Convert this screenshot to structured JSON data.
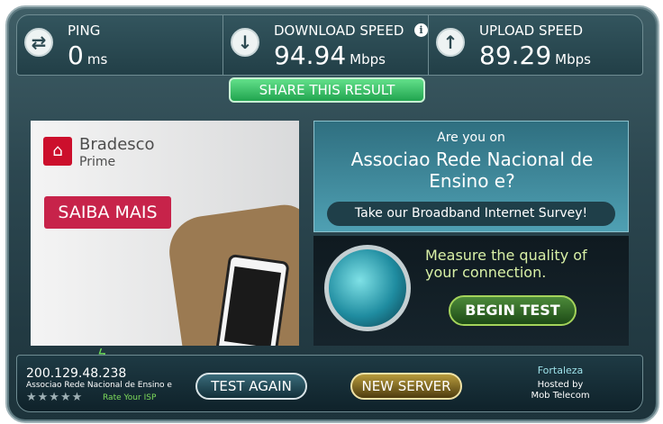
{
  "metrics": {
    "ping": {
      "label": "PING",
      "value": "0",
      "unit": "ms",
      "icon": "arrows-exchange-icon"
    },
    "download": {
      "label": "DOWNLOAD SPEED",
      "value": "94.94",
      "unit": "Mbps",
      "icon": "arrow-down-icon",
      "info": "i"
    },
    "upload": {
      "label": "UPLOAD SPEED",
      "value": "89.29",
      "unit": "Mbps",
      "icon": "arrow-up-icon"
    }
  },
  "share": {
    "label": "SHARE THIS RESULT"
  },
  "ad": {
    "brand": "Bradesco",
    "sub": "Prime",
    "cta": "SAIBA MAIS"
  },
  "survey": {
    "question": "Are you on",
    "isp": "Associao Rede Nacional de Ensino e?",
    "link": "Take our Broadband Internet Survey!"
  },
  "measure": {
    "text_line1": "Measure the quality of",
    "text_line2": "your connection.",
    "button": "BEGIN TEST"
  },
  "bottom": {
    "ip": "200.129.48.238",
    "isp": "Associao Rede Nacional de Ensino e",
    "rate": "Rate Your ISP",
    "stars": "★★★★★",
    "test_again": "TEST AGAIN",
    "new_server": "NEW SERVER",
    "city": "Fortaleza",
    "hosted_by": "Hosted by",
    "host": "Mob Telecom"
  },
  "colors": {
    "frame": "#2c4750",
    "share_green": "#21a44f",
    "begin_border": "#a4d35b",
    "ad_red": "#c7234a"
  }
}
